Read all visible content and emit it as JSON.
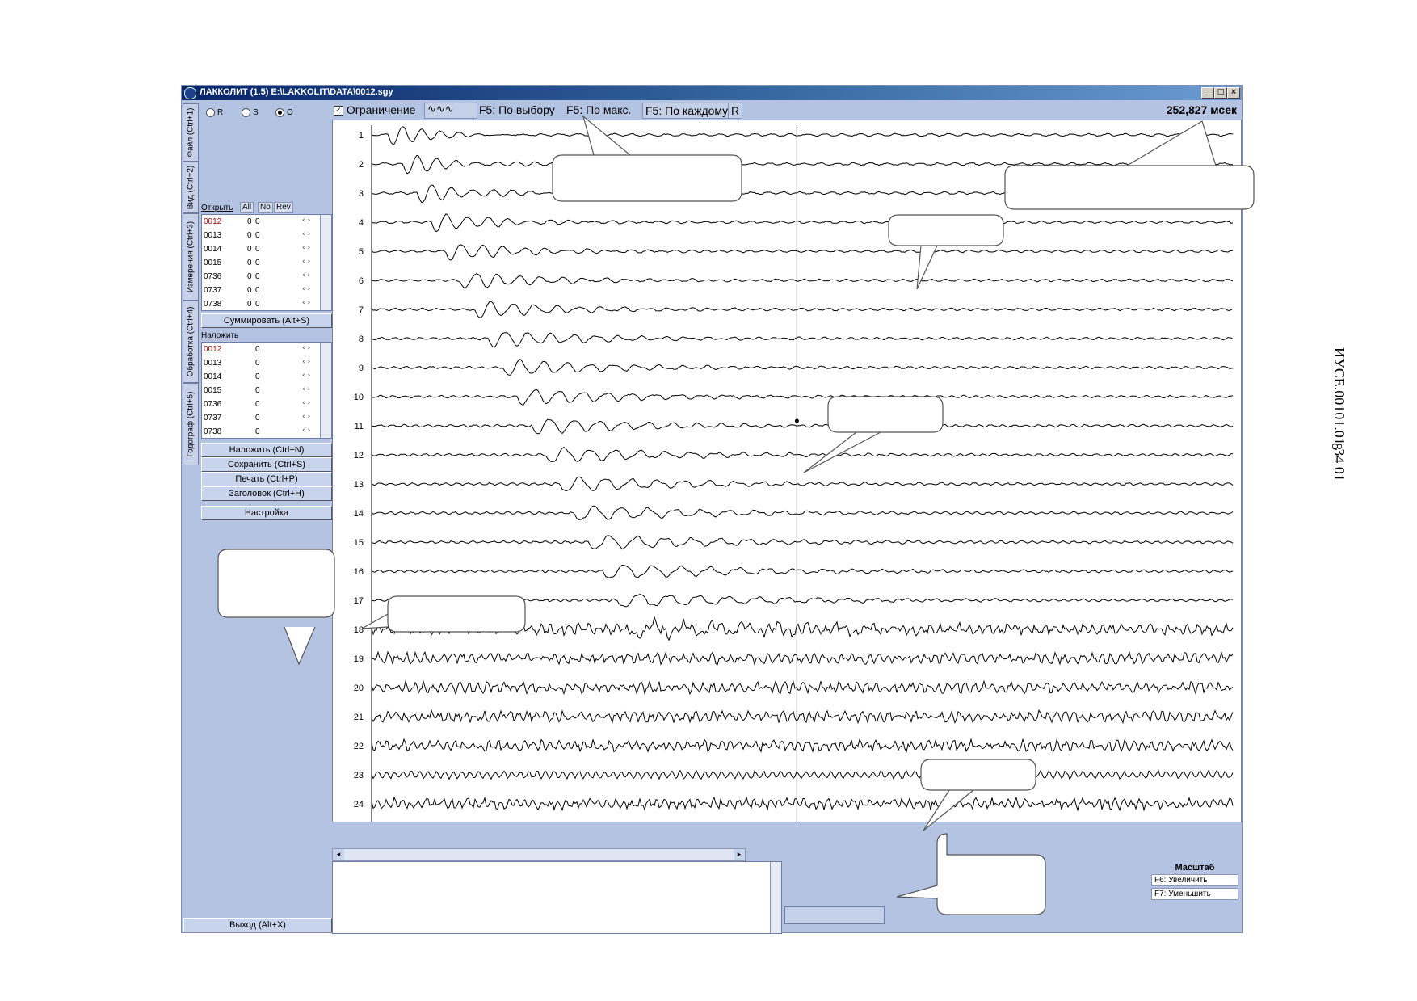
{
  "window": {
    "title": "ЛАККОЛИТ (1.5) E:\\LAKKOLIT\\DATA\\0012.sgy",
    "controls": [
      "_",
      "□",
      "×"
    ]
  },
  "page_number": "8",
  "doc_code": "ИУСЕ.00101.01 34 01",
  "radios": [
    {
      "label": "R",
      "checked": false
    },
    {
      "label": "S",
      "checked": false
    },
    {
      "label": "O",
      "checked": true
    }
  ],
  "vertical_tabs": [
    "Файл (Ctrl+1)",
    "Вид (Ctrl+2)",
    "Измерения (Ctrl+3)",
    "Обработка (Ctrl+4)",
    "Годограф (Ctrl+5)"
  ],
  "open_panel": {
    "link": "Открыть",
    "headers": [
      "All",
      "No",
      "Rev"
    ],
    "rows": [
      {
        "name": "0012",
        "a": "0",
        "b": "0",
        "active": true
      },
      {
        "name": "0013",
        "a": "0",
        "b": "0"
      },
      {
        "name": "0014",
        "a": "0",
        "b": "0"
      },
      {
        "name": "0015",
        "a": "0",
        "b": "0"
      },
      {
        "name": "0736",
        "a": "0",
        "b": "0"
      },
      {
        "name": "0737",
        "a": "0",
        "b": "0"
      },
      {
        "name": "0738",
        "a": "0",
        "b": "0"
      }
    ],
    "sum_button": "Суммировать (Alt+S)"
  },
  "overlay_panel": {
    "link": "Наложить",
    "rows": [
      {
        "name": "0012",
        "b": "0",
        "active": true
      },
      {
        "name": "0013",
        "b": "0"
      },
      {
        "name": "0014",
        "b": "0"
      },
      {
        "name": "0015",
        "b": "0"
      },
      {
        "name": "0736",
        "b": "0"
      },
      {
        "name": "0737",
        "b": "0"
      },
      {
        "name": "0738",
        "b": "0"
      }
    ]
  },
  "action_buttons": [
    "Наложить (Ctrl+N)",
    "Сохранить (Ctrl+S)",
    "Печать (Ctrl+P)",
    "Заголовок (Ctrl+H)"
  ],
  "settings_button": "Настройка",
  "exit_button": "Выход (Alt+X)",
  "toolbar": {
    "limit_checkbox": "Ограничение",
    "limit_checked": true,
    "by_selection": "F5: По выбору",
    "by_max": "F5: По макс.",
    "by_each": "F5: По каждому",
    "r_button": "R",
    "time_readout": "252,827 мсек"
  },
  "scale_panel": {
    "title": "Масштаб",
    "zoom_in": "F6: Увеличить",
    "zoom_out": "F7: Уменьшить"
  },
  "chart_data": {
    "type": "line",
    "traces": [
      1,
      2,
      3,
      4,
      5,
      6,
      7,
      8,
      9,
      10,
      11,
      12,
      13,
      14,
      15,
      16,
      17,
      18,
      19,
      20,
      21,
      22,
      23,
      24
    ],
    "x_ticks": [
      0,
      50,
      100,
      150,
      200,
      250,
      300,
      350,
      400,
      450,
      500
    ],
    "xlim": [
      0,
      512
    ],
    "cursor_x": 252.827,
    "grid": false
  }
}
